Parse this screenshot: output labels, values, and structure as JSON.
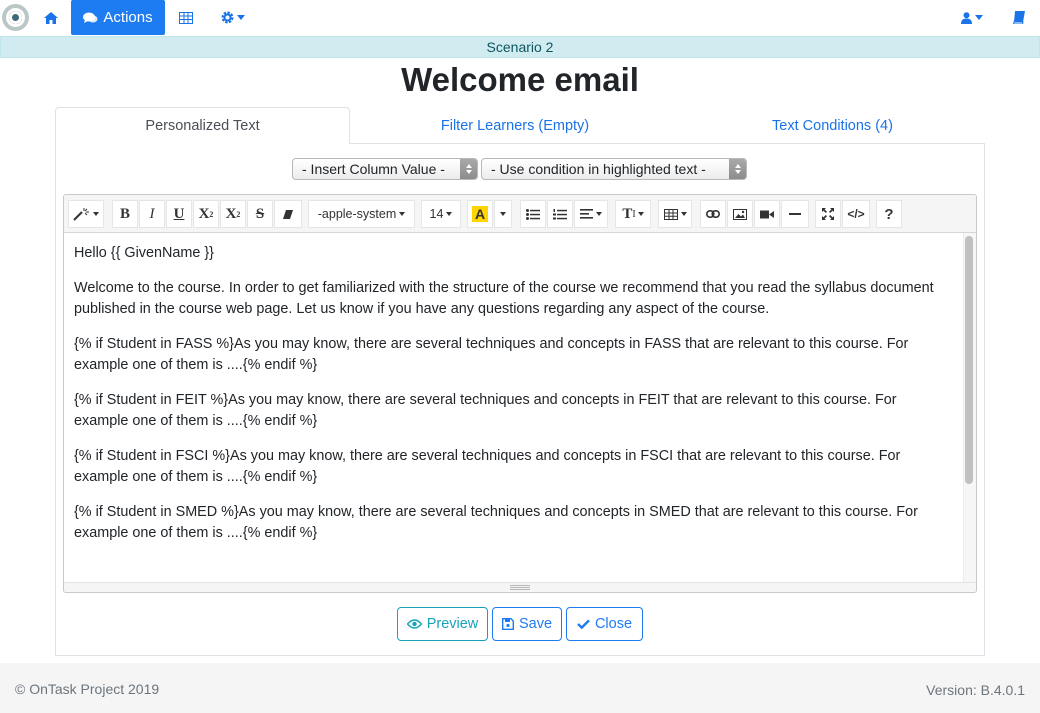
{
  "navbar": {
    "actions_label": "Actions",
    "icons": [
      "logo",
      "home-icon",
      "comments-icon",
      "table-icon",
      "gear-icon",
      "user-icon",
      "book-icon"
    ]
  },
  "scenario": "Scenario 2",
  "page_title": "Welcome email",
  "tabs": [
    {
      "label": "Personalized Text",
      "active": true
    },
    {
      "label": "Filter Learners (Empty)",
      "active": false
    },
    {
      "label": "Text Conditions (4)",
      "active": false
    }
  ],
  "selects": {
    "insert_column": "- Insert Column Value -",
    "use_condition": "- Use condition in highlighted text -"
  },
  "toolbar": {
    "font_family": "-apple-system",
    "font_size": "14",
    "text_color_letter": "A",
    "paragraph_style": "T",
    "help": "?",
    "code_view": "</>",
    "bold": "B",
    "italic": "I",
    "underline": "U",
    "superscript": "X",
    "subscript": "X",
    "strikethrough": "S",
    "superscript_mark": "2",
    "subscript_mark": "2",
    "paragraph_style_mark": "I"
  },
  "content": {
    "greeting": "Hello {{ GivenName }}",
    "intro": "Welcome to the course. In order to get familiarized with the structure of the course we recommend that you read the syllabus document published in the course web page. Let us know if you have any questions regarding any aspect of the course.",
    "conditions": [
      "{% if Student in FASS %}As you may know, there are several techniques and concepts in FASS that are relevant to this course. For example one of them is ....{% endif %}",
      "{% if Student in FEIT %}As you may know, there are several techniques and concepts in FEIT that are relevant to this course. For example one of them is ....{% endif %}",
      "{% if Student in FSCI %}As you may know, there are several techniques and concepts in FSCI that are relevant to this course. For example one of them is ....{% endif %}",
      "{% if Student in SMED %}As you may know, there are several techniques and concepts in SMED that are relevant to this course. For example one of them is ....{% endif %}"
    ]
  },
  "buttons": {
    "preview": "Preview",
    "save": "Save",
    "close": "Close"
  },
  "footer": {
    "copyright": "© OnTask Project 2019",
    "version": "Version: B.4.0.1"
  },
  "colors": {
    "primary": "#1e7cf2",
    "info": "#17a2b8",
    "scenario_bg": "#d1ecf1",
    "highlight_yellow": "#ffd400"
  }
}
